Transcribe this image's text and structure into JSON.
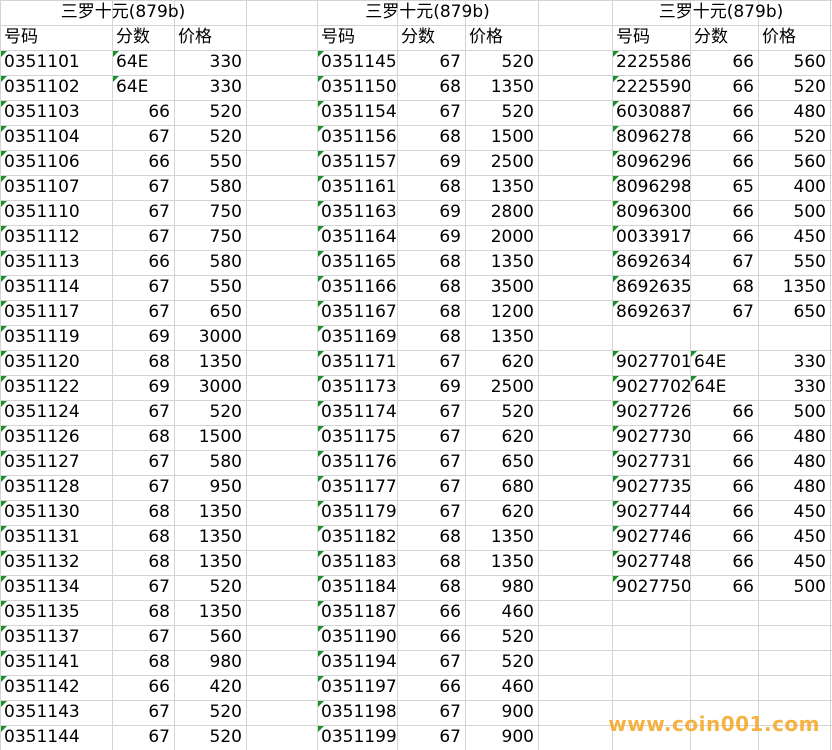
{
  "blocks": [
    {
      "title": "三罗十元(879b)",
      "headers": [
        "号码",
        "分数",
        "价格"
      ],
      "rows": [
        [
          "0351101",
          "64E",
          "330"
        ],
        [
          "0351102",
          "64E",
          "330"
        ],
        [
          "0351103",
          "66",
          "520"
        ],
        [
          "0351104",
          "67",
          "520"
        ],
        [
          "0351106",
          "66",
          "550"
        ],
        [
          "0351107",
          "67",
          "580"
        ],
        [
          "0351110",
          "67",
          "750"
        ],
        [
          "0351112",
          "67",
          "750"
        ],
        [
          "0351113",
          "66",
          "580"
        ],
        [
          "0351114",
          "67",
          "550"
        ],
        [
          "0351117",
          "67",
          "650"
        ],
        [
          "0351119",
          "69",
          "3000"
        ],
        [
          "0351120",
          "68",
          "1350"
        ],
        [
          "0351122",
          "69",
          "3000"
        ],
        [
          "0351124",
          "67",
          "520"
        ],
        [
          "0351126",
          "68",
          "1500"
        ],
        [
          "0351127",
          "67",
          "580"
        ],
        [
          "0351128",
          "67",
          "950"
        ],
        [
          "0351130",
          "68",
          "1350"
        ],
        [
          "0351131",
          "68",
          "1350"
        ],
        [
          "0351132",
          "68",
          "1350"
        ],
        [
          "0351134",
          "67",
          "520"
        ],
        [
          "0351135",
          "68",
          "1350"
        ],
        [
          "0351137",
          "67",
          "560"
        ],
        [
          "0351141",
          "68",
          "980"
        ],
        [
          "0351142",
          "66",
          "420"
        ],
        [
          "0351143",
          "67",
          "520"
        ],
        [
          "0351144",
          "67",
          "520"
        ]
      ]
    },
    {
      "title": "三罗十元(879b)",
      "headers": [
        "号码",
        "分数",
        "价格"
      ],
      "rows": [
        [
          "0351145",
          "67",
          "520"
        ],
        [
          "0351150",
          "68",
          "1350"
        ],
        [
          "0351154",
          "67",
          "520"
        ],
        [
          "0351156",
          "68",
          "1500"
        ],
        [
          "0351157",
          "69",
          "2500"
        ],
        [
          "0351161",
          "68",
          "1350"
        ],
        [
          "0351163",
          "69",
          "2800"
        ],
        [
          "0351164",
          "69",
          "2000"
        ],
        [
          "0351165",
          "68",
          "1350"
        ],
        [
          "0351166",
          "68",
          "3500"
        ],
        [
          "0351167",
          "68",
          "1200"
        ],
        [
          "0351169",
          "68",
          "1350"
        ],
        [
          "0351171",
          "67",
          "620"
        ],
        [
          "0351173",
          "69",
          "2500"
        ],
        [
          "0351174",
          "67",
          "520"
        ],
        [
          "0351175",
          "67",
          "620"
        ],
        [
          "0351176",
          "67",
          "650"
        ],
        [
          "0351177",
          "67",
          "680"
        ],
        [
          "0351179",
          "67",
          "620"
        ],
        [
          "0351182",
          "68",
          "1350"
        ],
        [
          "0351183",
          "68",
          "1350"
        ],
        [
          "0351184",
          "68",
          "980"
        ],
        [
          "0351187",
          "66",
          "460"
        ],
        [
          "0351190",
          "66",
          "520"
        ],
        [
          "0351194",
          "67",
          "520"
        ],
        [
          "0351197",
          "66",
          "460"
        ],
        [
          "0351198",
          "67",
          "900"
        ],
        [
          "0351199",
          "67",
          "900"
        ]
      ]
    },
    {
      "title": "三罗十元(879b)",
      "headers": [
        "号码",
        "分数",
        "价格"
      ],
      "rows": [
        [
          "2225586",
          "66",
          "560"
        ],
        [
          "2225590",
          "66",
          "520"
        ],
        [
          "6030887",
          "66",
          "480"
        ],
        [
          "8096278",
          "66",
          "520"
        ],
        [
          "8096296",
          "66",
          "560"
        ],
        [
          "8096298",
          "65",
          "400"
        ],
        [
          "8096300",
          "66",
          "500"
        ],
        [
          "0033917",
          "66",
          "450"
        ],
        [
          "8692634",
          "67",
          "550"
        ],
        [
          "8692635",
          "68",
          "1350"
        ],
        [
          "8692637",
          "67",
          "650"
        ],
        [
          "",
          "",
          ""
        ],
        [
          "9027701",
          "64E",
          "330"
        ],
        [
          "9027702",
          "64E",
          "330"
        ],
        [
          "9027726",
          "66",
          "500"
        ],
        [
          "9027730",
          "66",
          "480"
        ],
        [
          "9027731",
          "66",
          "480"
        ],
        [
          "9027735",
          "66",
          "480"
        ],
        [
          "9027744",
          "66",
          "450"
        ],
        [
          "9027746",
          "66",
          "450"
        ],
        [
          "9027748",
          "66",
          "450"
        ],
        [
          "9027750",
          "66",
          "500"
        ]
      ]
    }
  ],
  "watermark": "www.coin001.com"
}
